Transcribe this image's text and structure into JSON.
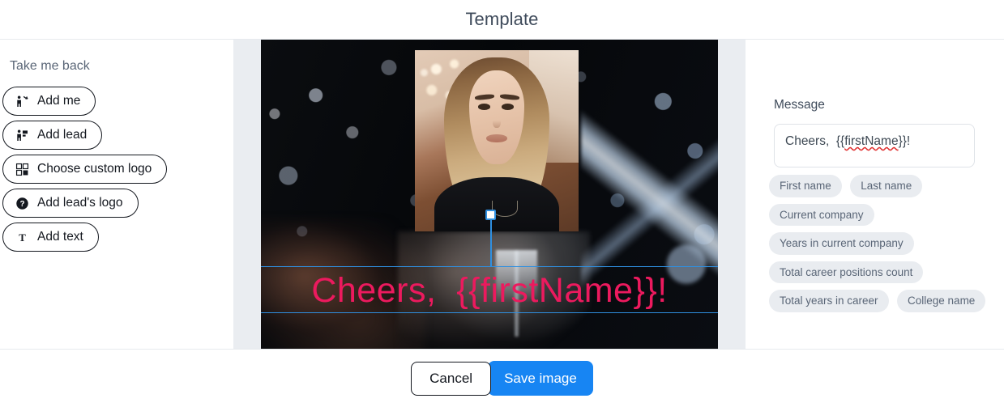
{
  "header": {
    "title": "Template"
  },
  "left_panel": {
    "back_link": "Take me back",
    "tools": [
      {
        "label": "Add me",
        "icon": "person-add-icon"
      },
      {
        "label": "Add lead",
        "icon": "person-lead-icon"
      },
      {
        "label": "Choose custom logo",
        "icon": "grid-logo-icon"
      },
      {
        "label": "Add lead's logo",
        "icon": "question-circle-icon"
      },
      {
        "label": "Add text",
        "icon": "text-t-icon"
      }
    ]
  },
  "canvas": {
    "overlay_text": "Cheers,  {{firstName}}!",
    "overlay_text_color": "#ec1a5e",
    "selection_color": "#2f8fe0",
    "gutter_color": "#eaedf1",
    "portrait_alt": "portrait-photo-inset",
    "background_alt": "party-bokeh-photo"
  },
  "right_panel": {
    "message_label": "Message",
    "message_value_prefix": "Cheers,  {{",
    "message_value_spell": "firstName",
    "message_value_suffix": "}}!",
    "message_placeholder": "Message",
    "chips": [
      "First name",
      "Last name",
      "Current company",
      "Years in current company",
      "Total career positions count",
      "Total years in career",
      "College name"
    ]
  },
  "footer": {
    "cancel_label": "Cancel",
    "save_label": "Save image",
    "save_color": "#1785f3"
  }
}
